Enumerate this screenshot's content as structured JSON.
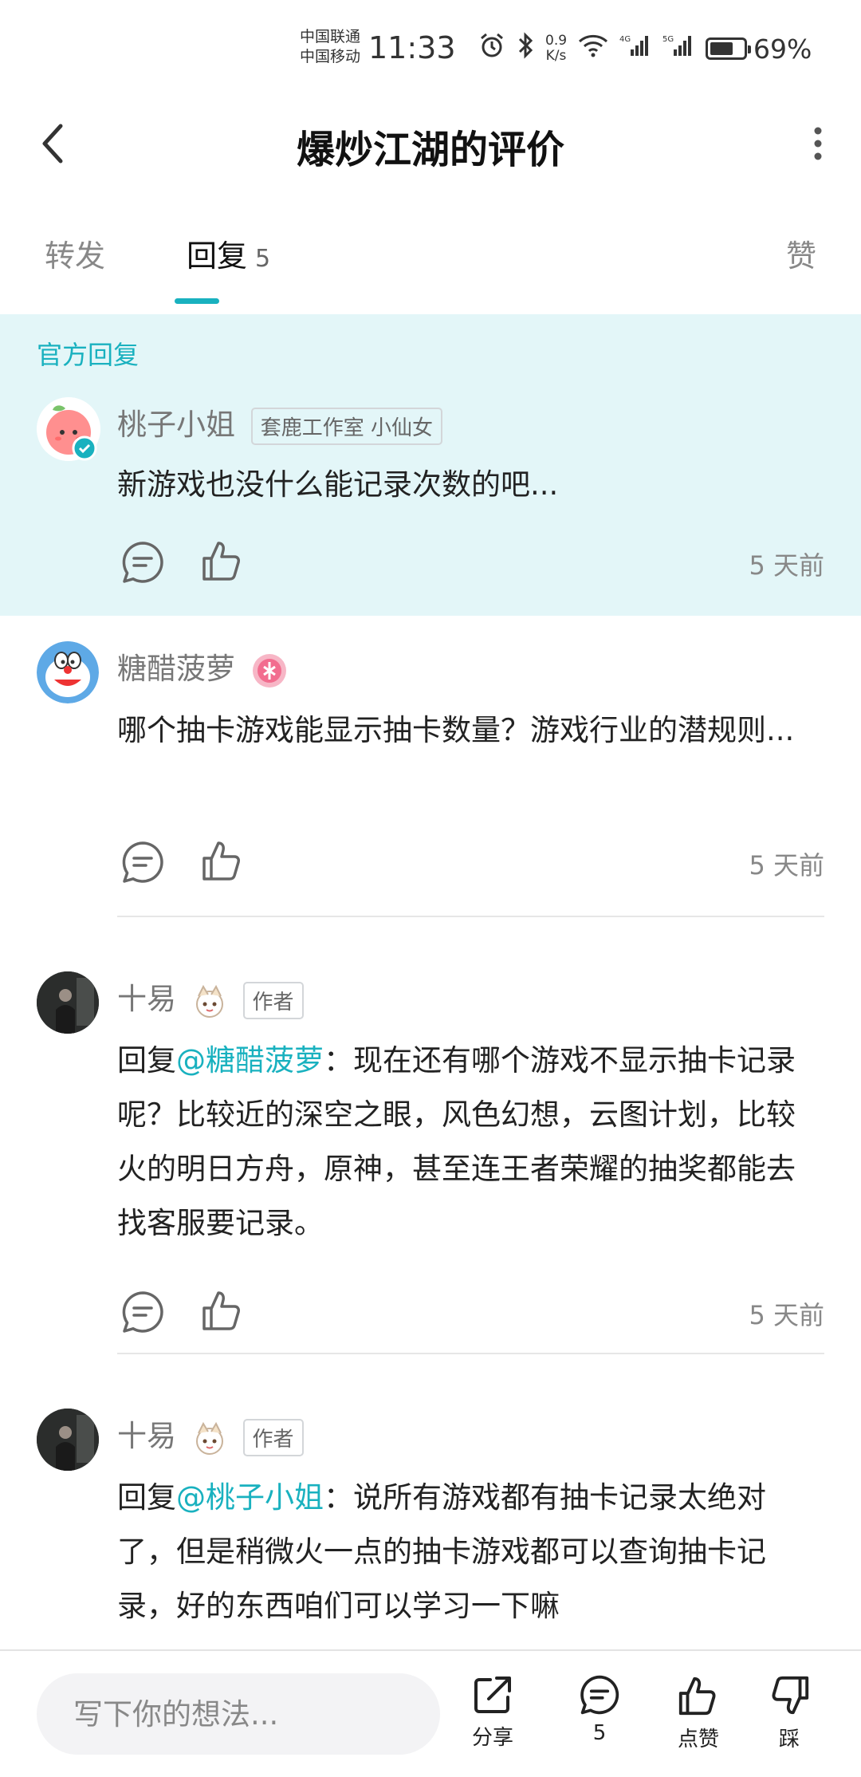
{
  "status_bar": {
    "carrier_1": "中国联通",
    "carrier_2": "中国移动",
    "time": "11:33",
    "net_speed_value": "0.9",
    "net_speed_unit": "K/s",
    "signal_1": "4G",
    "signal_2": "5G",
    "battery_percent": 69,
    "battery_text": "69%"
  },
  "header": {
    "title": "爆炒江湖的评价",
    "back_icon": "chevron-left-icon",
    "more_icon": "more-vertical-icon"
  },
  "tabs": {
    "repost": "转发",
    "reply": "回复",
    "reply_count": "5",
    "like": "赞",
    "active": "reply"
  },
  "official_reply": {
    "section_label": "官方回复",
    "username": "桃子小姐",
    "tag": "套鹿工作室 小仙女",
    "text": "新游戏也没什么能记录次数的吧...",
    "time": "5 天前"
  },
  "comments": [
    {
      "username": "糖醋菠萝",
      "text": "哪个抽卡游戏能显示抽卡数量？游戏行业的潜规则...",
      "time": "5 天前"
    },
    {
      "username": "十易",
      "tag": "作者",
      "reply_prefix": "回复",
      "mention": "@糖醋菠萝",
      "text": "：现在还有哪个游戏不显示抽卡记录呢？比较近的深空之眼，风色幻想，云图计划，比较火的明日方舟，原神，甚至连王者荣耀的抽奖都能去找客服要记录。",
      "time": "5 天前"
    },
    {
      "username": "十易",
      "tag": "作者",
      "reply_prefix": "回复",
      "mention": "@桃子小姐",
      "text": "：说所有游戏都有抽卡记录太绝对了，但是稍微火一点的抽卡游戏都可以查询抽卡记录，好的东西咱们可以学习一下嘛"
    }
  ],
  "bottom_bar": {
    "input_placeholder": "写下你的想法...",
    "share_label": "分享",
    "comment_count": "5",
    "like_label": "点赞",
    "dislike_label": "踩"
  },
  "colors": {
    "accent": "#19b1bf",
    "official_bg": "#e3f6f8"
  }
}
